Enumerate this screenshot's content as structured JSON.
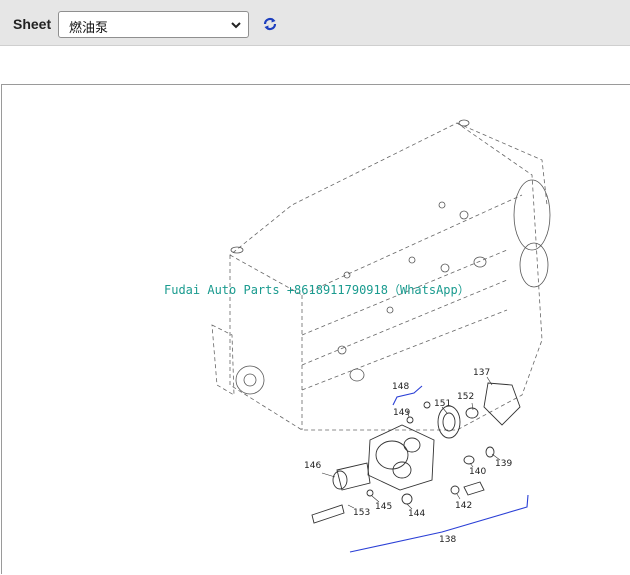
{
  "toolbar": {
    "sheet_label": "Sheet",
    "sheet_value": "燃油泵",
    "refresh_icon": "refresh-icon",
    "chevron_icon": "chevron-down-icon"
  },
  "diagram": {
    "watermark": "Fudai Auto Parts +8618911790918（WhatsApp）",
    "callouts": [
      "137",
      "138",
      "139",
      "140",
      "142",
      "144",
      "145",
      "146",
      "148",
      "149",
      "151",
      "152",
      "153"
    ],
    "accent_color": "#2a3fd6"
  }
}
